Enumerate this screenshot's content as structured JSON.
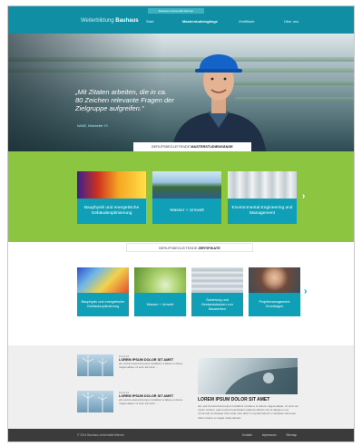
{
  "header": {
    "top_link": "Bauhaus-Universität Weimar",
    "logo_prefix": "Weiterbildung",
    "logo_main": "Bauhaus",
    "nav": [
      {
        "label": "Start"
      },
      {
        "label": "Masterstudiengänge",
        "active": true
      },
      {
        "label": "Zertifikate"
      },
      {
        "label": "Über uns"
      }
    ]
  },
  "hero": {
    "quote": "„Mit Zitaten arbeiten, die in ca. 80 Zeichen relevante Fragen der Zielgruppe aufgreifen.“",
    "source": "NAME, Mitarbeiter XY"
  },
  "masters": {
    "label_prefix": "BERUFSBEGLEITENDE",
    "label_bold": "MASTERSTUDIENGÄNGE",
    "tiles": [
      {
        "label": "Bauphysik und energetische Gebäudeoptimierung"
      },
      {
        "label": "Wasser + Umwelt"
      },
      {
        "label": "Environmental Engineering and Management"
      }
    ]
  },
  "certificates": {
    "label_prefix": "BERUFSBEGLEITENDE",
    "label_bold": "ZERTIFIKATE",
    "tiles": [
      {
        "label": "Bauphysik und energetische Gebäudeoptimierung"
      },
      {
        "label": "Wasser + Umwelt"
      },
      {
        "label": "Sanierung und Bestandsbauten von Bauwerken"
      },
      {
        "label": "Projektmanagement Grundlagen"
      }
    ]
  },
  "news": {
    "items": [
      {
        "date": "12.12.14",
        "title": "LOREM IPSUM DOLOR SIT AMET",
        "text": "elit, sed do eiusmod tempor incididunt ut labore et dolore magna aliqua. Ut enim ad minim ..."
      },
      {
        "date": "12.12.14",
        "title": "LOREM IPSUM DOLOR SIT AMET",
        "text": "elit, sed do eiusmod tempor incididunt ut labore et dolore magna aliqua. Ut enim ad minim ..."
      }
    ],
    "featured": {
      "title": "LOREM IPSUM DOLOR SIT AMET",
      "text": "elit, sed do eiusmod tempor incididunt ut labore et dolore magna aliqua. Ut enim ad minim veniam, quis nostrud exercitation ullamco laboris nisi ut aliquip ex ea commodo consequat. Duis aute irure dolor in reprehenderit in voluptate velit esse cillum dolore eu fugiat nulla pariatur."
    }
  },
  "footer": {
    "copyright": "© 2014 Bauhaus-Universität Weimar",
    "links": [
      "Kontakt",
      "Impressum",
      "Sitemap"
    ]
  },
  "colors": {
    "teal": "#0f8ea4",
    "tile_teal": "#0f9fb7",
    "green": "#8cc53f",
    "footer": "#3b3b3b"
  }
}
